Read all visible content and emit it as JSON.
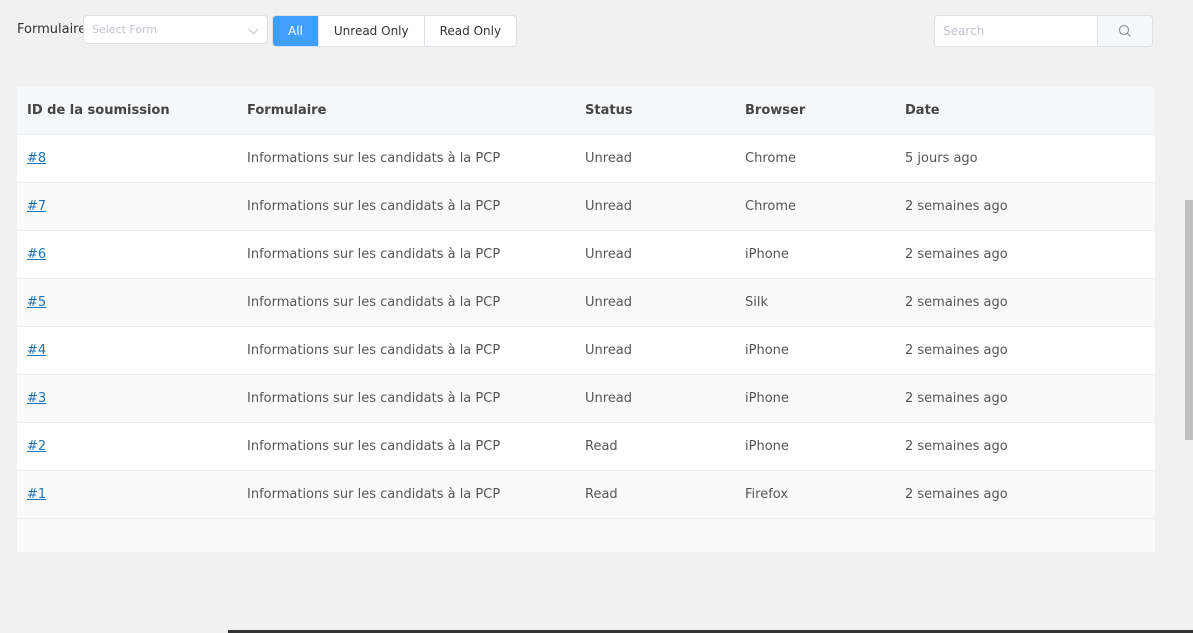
{
  "filters": {
    "form_label": "Formulaire",
    "select_placeholder": "Select Form",
    "status_buttons": [
      "All",
      "Unread Only",
      "Read Only"
    ],
    "active_status": "All",
    "search_placeholder": "Search"
  },
  "table": {
    "columns": [
      "ID de la soumission",
      "Formulaire",
      "Status",
      "Browser",
      "Date"
    ],
    "rows": [
      {
        "id": "#8",
        "form": "Informations sur les candidats à la PCP",
        "status": "Unread",
        "browser": "Chrome",
        "date": "5 jours ago"
      },
      {
        "id": "#7",
        "form": "Informations sur les candidats à la PCP",
        "status": "Unread",
        "browser": "Chrome",
        "date": "2 semaines ago"
      },
      {
        "id": "#6",
        "form": "Informations sur les candidats à la PCP",
        "status": "Unread",
        "browser": "iPhone",
        "date": "2 semaines ago"
      },
      {
        "id": "#5",
        "form": "Informations sur les candidats à la PCP",
        "status": "Unread",
        "browser": "Silk",
        "date": "2 semaines ago"
      },
      {
        "id": "#4",
        "form": "Informations sur les candidats à la PCP",
        "status": "Unread",
        "browser": "iPhone",
        "date": "2 semaines ago"
      },
      {
        "id": "#3",
        "form": "Informations sur les candidats à la PCP",
        "status": "Unread",
        "browser": "iPhone",
        "date": "2 semaines ago"
      },
      {
        "id": "#2",
        "form": "Informations sur les candidats à la PCP",
        "status": "Read",
        "browser": "iPhone",
        "date": "2 semaines ago"
      },
      {
        "id": "#1",
        "form": "Informations sur les candidats à la PCP",
        "status": "Read",
        "browser": "Firefox",
        "date": "2 semaines ago"
      }
    ]
  },
  "colors": {
    "accent": "#409eff",
    "link": "#1a73b8"
  }
}
